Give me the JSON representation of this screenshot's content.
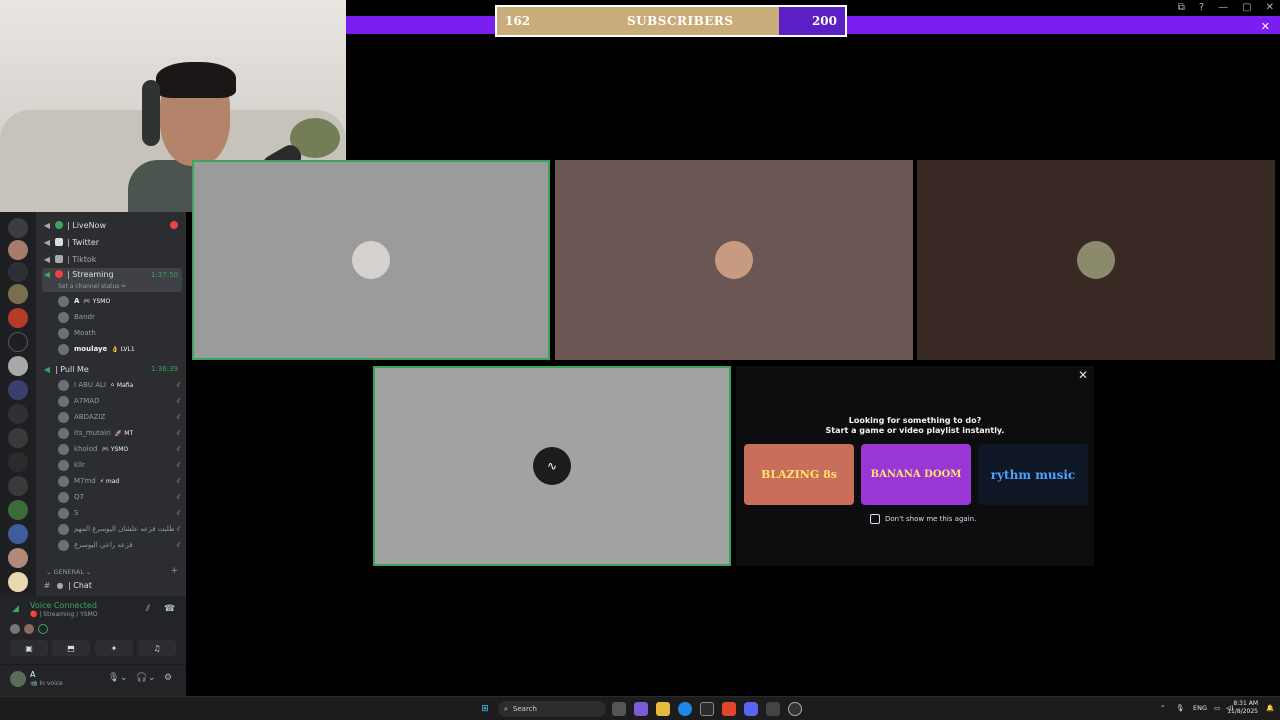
{
  "overlay": {
    "subscriber_goal": {
      "current": "162",
      "label": "SUBSCRIBERS",
      "goal": "200",
      "progress_fraction": 0.81
    },
    "colors": {
      "bar": "#7a1ff0",
      "fill": "#c9ac7a",
      "remaining": "#5a20c6"
    }
  },
  "window": {
    "icons": [
      "cast-icon",
      "help-icon",
      "minimize-icon",
      "maximize-icon"
    ],
    "close_glyph": "✕"
  },
  "channels": {
    "top": [
      {
        "name": "| LiveNow",
        "type": "announcement",
        "status_color": "#3ba55c",
        "badge": true
      },
      {
        "name": "| Twitter",
        "type": "announcement",
        "status_color": "#dbdee1"
      },
      {
        "name": "| Tiktok",
        "type": "announcement",
        "status_color": "#a7a9ad"
      }
    ],
    "streaming": {
      "name": "| Streaming",
      "time": "1:37:50",
      "status": "Set a channel status ✏"
    },
    "streaming_users": [
      {
        "name": "A",
        "tag": "🎮 YSMO",
        "bright": true
      },
      {
        "name": "Bandr",
        "tag": ""
      },
      {
        "name": "Moath",
        "tag": ""
      },
      {
        "name": "moulaye",
        "tag": "👌 LVL1",
        "bright": true
      }
    ],
    "pullme": {
      "name": "| Pull Me",
      "time": "1:36:39"
    },
    "pullme_users": [
      {
        "name": "I ABU ALI",
        "tag": "⚪ Mafia"
      },
      {
        "name": "A7MAD",
        "tag": ""
      },
      {
        "name": "ABDAZIZ",
        "tag": ""
      },
      {
        "name": "its_mutairi",
        "tag": "🚀 MT"
      },
      {
        "name": "kholod",
        "tag": "🎮 YSMO"
      },
      {
        "name": "kllr",
        "tag": ""
      },
      {
        "name": "M7md",
        "tag": "⚡ mad"
      },
      {
        "name": "Q7",
        "tag": ""
      },
      {
        "name": "S",
        "tag": ""
      },
      {
        "name": "طلبت فزعه علشان اليوسرع المهم",
        "tag": ""
      },
      {
        "name": "فزعه راعي اليوسرع",
        "tag": ""
      }
    ],
    "category": "⌄ GENERAL ⌄",
    "chat": "| Chat"
  },
  "voice": {
    "title": "Voice Connected",
    "subtitle": "🔴 | Streaming / YSMO",
    "buttons": [
      "camera-off-icon",
      "screen-share-icon",
      "activity-icon",
      "soundboard-icon"
    ]
  },
  "user_panel": {
    "name": "A",
    "sub": "📹 In voice"
  },
  "tiles": [
    {
      "name": "tile-1",
      "bg": "#9b9b9b",
      "speaking": true
    },
    {
      "name": "tile-2",
      "bg": "#6b5653",
      "speaking": false
    },
    {
      "name": "tile-3",
      "bg": "#3a2a26",
      "speaking": false
    },
    {
      "name": "tile-4",
      "bg": "#a2a3a1",
      "speaking": true
    }
  ],
  "activity": {
    "line1": "Looking for something to do?",
    "line2": "Start a game or video playlist instantly.",
    "cards": [
      {
        "title": "BLAZING 8s",
        "bg": "#c96e5a"
      },
      {
        "title": "BANANA DOOM",
        "bg": "#9a35d6"
      },
      {
        "title": "rythm music",
        "bg": "#0f1626"
      }
    ],
    "checkbox_label": "Don't show me this again."
  },
  "taskbar": {
    "search": "Search",
    "lang": "ENG",
    "time": "8:31 AM",
    "date": "11/8/2025"
  }
}
